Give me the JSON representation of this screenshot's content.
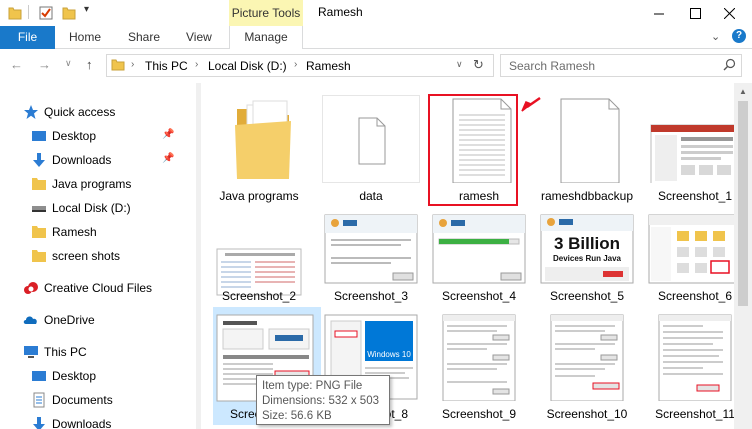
{
  "titlebar": {
    "context_tab": "Picture Tools",
    "window_title": "Ramesh"
  },
  "ribbon": {
    "tabs": [
      "File",
      "Home",
      "Share",
      "View",
      "Manage"
    ]
  },
  "nav": {
    "path": [
      "This PC",
      "Local Disk (D:)",
      "Ramesh"
    ],
    "search_placeholder": "Search Ramesh"
  },
  "sidebar": {
    "items": [
      {
        "label": "Quick access",
        "icon": "star-icon",
        "pinned": false
      },
      {
        "label": "Desktop",
        "icon": "desktop-icon",
        "pinned": true
      },
      {
        "label": "Downloads",
        "icon": "download-icon",
        "pinned": true
      },
      {
        "label": "Java programs",
        "icon": "folder-icon",
        "pinned": false
      },
      {
        "label": "Local Disk (D:)",
        "icon": "drive-icon",
        "pinned": false
      },
      {
        "label": "Ramesh",
        "icon": "folder-icon",
        "pinned": false
      },
      {
        "label": "screen shots",
        "icon": "folder-icon",
        "pinned": false
      },
      {
        "label": "Creative Cloud Files",
        "icon": "creative-cloud-icon",
        "pinned": false
      },
      {
        "label": "OneDrive",
        "icon": "cloud-icon",
        "pinned": false
      },
      {
        "label": "This PC",
        "icon": "computer-icon",
        "pinned": false
      },
      {
        "label": "Desktop",
        "icon": "desktop-icon",
        "pinned": false
      },
      {
        "label": "Documents",
        "icon": "documents-icon",
        "pinned": false
      },
      {
        "label": "Downloads",
        "icon": "download-icon",
        "pinned": false
      }
    ]
  },
  "files": [
    {
      "name": "Java programs",
      "kind": "folder"
    },
    {
      "name": "data",
      "kind": "file"
    },
    {
      "name": "ramesh",
      "kind": "text"
    },
    {
      "name": "rameshdbbackup",
      "kind": "file"
    },
    {
      "name": "Screenshot_1",
      "kind": "image"
    },
    {
      "name": "Screenshot_2",
      "kind": "image"
    },
    {
      "name": "Screenshot_3",
      "kind": "image"
    },
    {
      "name": "Screenshot_4",
      "kind": "image"
    },
    {
      "name": "Screenshot_5",
      "kind": "image"
    },
    {
      "name": "Screenshot_6",
      "kind": "image"
    },
    {
      "name": "Screenshot_7",
      "kind": "image"
    },
    {
      "name": "Screenshot_8",
      "kind": "image"
    },
    {
      "name": "Screenshot_9",
      "kind": "image"
    },
    {
      "name": "Screenshot_10",
      "kind": "image"
    },
    {
      "name": "Screenshot_11",
      "kind": "image"
    }
  ],
  "thumb_text": {
    "billion_big": "3 Billion",
    "billion_sub": "Devices Run Java",
    "windows_logo": "Windows 10"
  },
  "tooltip": {
    "line1": "Item type: PNG File",
    "line2": "Dimensions: 532 x 503",
    "line3": "Size: 56.6 KB"
  },
  "colors": {
    "file_tab": "#1979ca",
    "context_tab": "#fbf6b3",
    "selection": "#cce8ff",
    "highlight": "#e81123",
    "folder": "#f0c44c"
  }
}
